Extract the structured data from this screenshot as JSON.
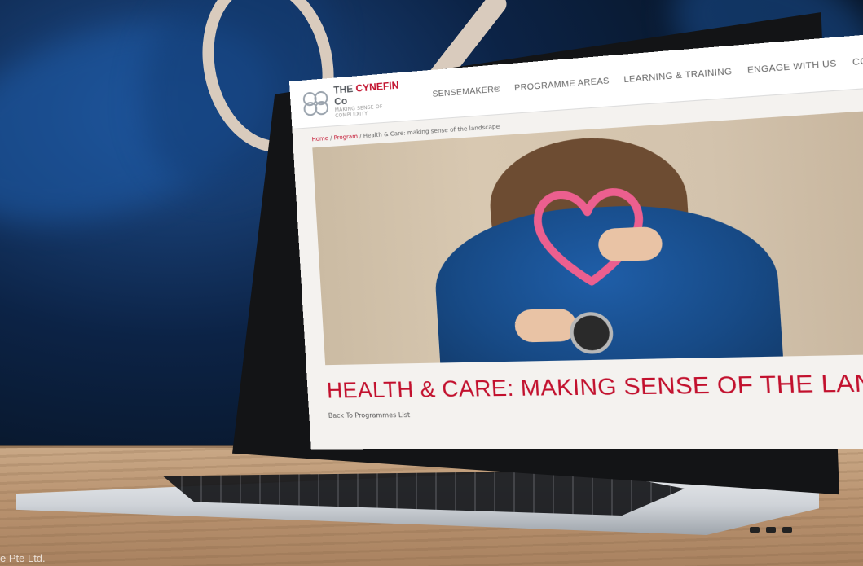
{
  "site": {
    "brand_prefix": "THE",
    "brand_name": "CYNEFIN",
    "brand_suffix": "Co",
    "tagline": "MAKING SENSE OF COMPLEXITY"
  },
  "nav": {
    "items": [
      {
        "label": "SENSEMAKER®"
      },
      {
        "label": "PROGRAMME AREAS"
      },
      {
        "label": "LEARNING & TRAINING"
      },
      {
        "label": "ENGAGE WITH US"
      },
      {
        "label": "CONTACT"
      }
    ]
  },
  "breadcrumb": {
    "home": "Home",
    "separator": "/",
    "program": "Program",
    "current": "Health & Care: making sense of the landscape"
  },
  "page": {
    "title": "HEALTH & CARE: MAKING SENSE OF THE LANDSCAPE",
    "back_link": "Back To Programmes List"
  },
  "watermark": {
    "text": "e Pte Ltd."
  },
  "colors": {
    "accent": "#c2102d",
    "nav_text": "#666666",
    "page_background": "#f4f2ef",
    "desk": "#b99370",
    "backdrop": "#0c2346"
  },
  "icons": {
    "logo": "cynefin-circles-logo-icon"
  }
}
